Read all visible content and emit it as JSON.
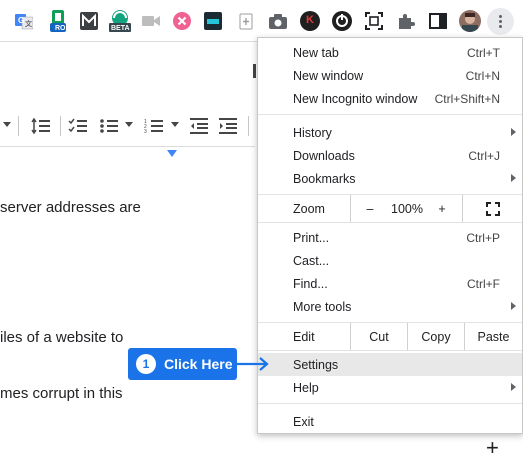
{
  "extensions": [
    {
      "icon": "translate-icon",
      "color": "#4285f4"
    },
    {
      "icon": "ro-extension-icon",
      "badge": "RO",
      "color": "#0f9d58"
    },
    {
      "icon": "m-extension-icon",
      "color": "#3c4043"
    },
    {
      "icon": "beta-extension-icon",
      "badge": "BETA",
      "color": "#12a37f"
    },
    {
      "icon": "video-camera-icon",
      "color": "#bdbdbd"
    },
    {
      "icon": "x-extension-icon",
      "color": "#f06292"
    },
    {
      "icon": "sheets-extension-icon",
      "color": "#1b2b34"
    },
    {
      "icon": "clipboard-icon",
      "color": "#9e9e9e"
    },
    {
      "icon": "camera-icon",
      "color": "#5f6368"
    },
    {
      "icon": "k-extension-icon",
      "badge": "K",
      "color": "#1f1f1f"
    },
    {
      "icon": "circle-extension-icon",
      "color": "#1f1f1f"
    },
    {
      "icon": "screenshot-icon",
      "color": "#202124"
    },
    {
      "icon": "puzzle-icon",
      "color": "#5f6368"
    },
    {
      "icon": "sidepanel-icon",
      "color": "#202124"
    },
    {
      "icon": "avatar",
      "color": "#8d6e63"
    }
  ],
  "doc": {
    "lines": [
      "server addresses are",
      "iles of a website to",
      "mes corrupt in this"
    ]
  },
  "menu": {
    "group1": [
      {
        "label": "New tab",
        "shortcut": "Ctrl+T"
      },
      {
        "label": "New window",
        "shortcut": "Ctrl+N"
      },
      {
        "label": "New Incognito window",
        "shortcut": "Ctrl+Shift+N"
      }
    ],
    "group2": [
      {
        "label": "History",
        "shortcut": ""
      },
      {
        "label": "Downloads",
        "shortcut": "Ctrl+J"
      },
      {
        "label": "Bookmarks",
        "shortcut": ""
      }
    ],
    "zoom": {
      "label": "Zoom",
      "minus": "–",
      "value": "100%",
      "plus": "+"
    },
    "group3": [
      {
        "label": "Print...",
        "shortcut": "Ctrl+P"
      },
      {
        "label": "Cast...",
        "shortcut": ""
      },
      {
        "label": "Find...",
        "shortcut": "Ctrl+F"
      },
      {
        "label": "More tools",
        "shortcut": ""
      }
    ],
    "edit": {
      "label": "Edit",
      "cut": "Cut",
      "copy": "Copy",
      "paste": "Paste"
    },
    "group4": [
      {
        "label": "Settings"
      },
      {
        "label": "Help"
      }
    ],
    "exit": {
      "label": "Exit"
    }
  },
  "callout": {
    "number": "1",
    "text": "Click Here",
    "color": "#1a73e8"
  },
  "plus_button": "+"
}
